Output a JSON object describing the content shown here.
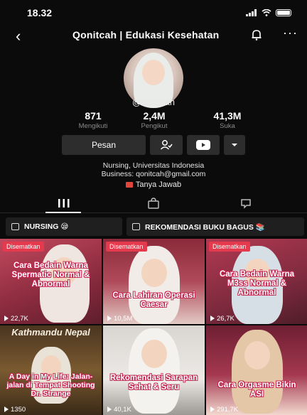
{
  "status_bar": {
    "time": "18.32"
  },
  "header": {
    "title": "Qonitcah | Edukasi Kesehatan",
    "back_glyph": "‹",
    "more_glyph": "···"
  },
  "profile": {
    "handle": "@qonitcah",
    "stats": [
      {
        "value": "871",
        "label": "Mengikuti"
      },
      {
        "value": "2,4M",
        "label": "Pengikut"
      },
      {
        "value": "41,3M",
        "label": "Suka"
      }
    ],
    "message_button": "Pesan",
    "bio_line1": "Nursing, Universitas Indonesia",
    "bio_line2": "Business: qonitcah@gmail.com",
    "qa_label": "Tanya Jawab"
  },
  "playlists": [
    {
      "label": "NURSING 😪"
    },
    {
      "label": "REKOMENDASI BUKU BAGUS 📚"
    }
  ],
  "videos": [
    {
      "pinned": "Disematkan",
      "caption": "Cara Bedain Warna Spermatic Normal & Abnormal",
      "views": "22,7K",
      "top": ""
    },
    {
      "pinned": "Disematkan",
      "caption": "Cara Lahiran Operasi Caesar",
      "views": "10,5M",
      "top": ""
    },
    {
      "pinned": "Disematkan",
      "caption": "Cara Bedain Warna M3ss Normal & Abnormal",
      "views": "26,7K",
      "top": ""
    },
    {
      "pinned": "",
      "caption": "A Day in My Life: Jalan-jalan di Tempat Shooting Dr. Strange",
      "views": "1350",
      "top": "Kathmandu Nepal"
    },
    {
      "pinned": "",
      "caption": "Rekomendasi Sarapan Sehat & Seru",
      "views": "40,1K",
      "top": ""
    },
    {
      "pinned": "",
      "caption": "Cara Orgasme Bikin ASI",
      "views": "291,7K",
      "top": ""
    }
  ],
  "colors": {
    "background": "#0b0b0b",
    "pinned_badge": "#e53a4d",
    "caption_outline": "#c3224d"
  }
}
